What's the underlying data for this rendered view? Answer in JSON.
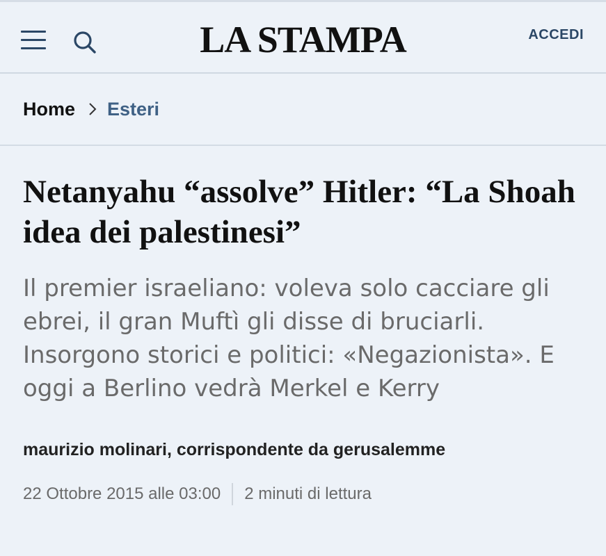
{
  "header": {
    "logo": "LA STAMPA",
    "login_label": "ACCEDI",
    "icons": [
      "menu-icon",
      "search-icon"
    ]
  },
  "breadcrumb": {
    "home": "Home",
    "category": "Esteri",
    "separator_icon": "chevron-right-icon"
  },
  "article": {
    "headline": "Netanyahu “assolve” Hitler: “La Shoah idea dei palestinesi”",
    "summary": "Il premier israeliano: voleva solo cacciare gli ebrei, il gran Muftì gli disse di bruciarli. Insorgono storici e politici: «Negazionista». E oggi a Berlino vedrà Merkel e Kerry",
    "author": "maurizio molinari, corrispondente da gerusalemme",
    "date": "22 Ottobre 2015 alle 03:00",
    "reading_time": "2 minuti di lettura"
  },
  "colors": {
    "background": "#edf2f8",
    "accent": "#2b4766",
    "category": "#3f6185",
    "summary_text": "#6a6a6a"
  }
}
